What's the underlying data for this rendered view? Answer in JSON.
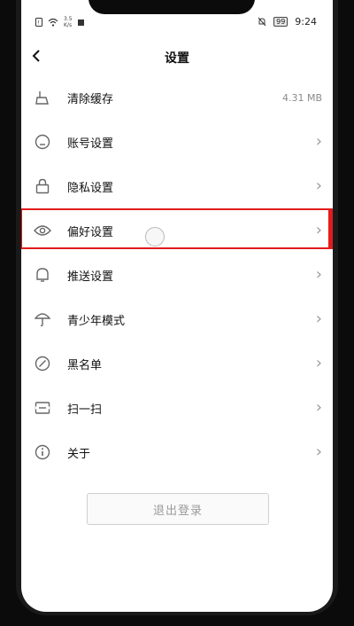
{
  "status": {
    "speed_value": "3.5",
    "speed_unit": "K/s",
    "battery": "99",
    "time": "9:24"
  },
  "header": {
    "title": "设置"
  },
  "items": [
    {
      "label": "清除缓存",
      "value": "4.31 MB",
      "icon": "broom-icon"
    },
    {
      "label": "账号设置",
      "value": "",
      "icon": "account-icon"
    },
    {
      "label": "隐私设置",
      "value": "",
      "icon": "lock-icon"
    },
    {
      "label": "偏好设置",
      "value": "",
      "icon": "eye-icon"
    },
    {
      "label": "推送设置",
      "value": "",
      "icon": "bell-icon"
    },
    {
      "label": "青少年模式",
      "value": "",
      "icon": "umbrella-icon"
    },
    {
      "label": "黑名单",
      "value": "",
      "icon": "block-icon"
    },
    {
      "label": "扫一扫",
      "value": "",
      "icon": "scan-icon"
    },
    {
      "label": "关于",
      "value": "",
      "icon": "info-icon"
    }
  ],
  "logout_label": "退出登录",
  "colors": {
    "highlight": "#e21b1b"
  }
}
